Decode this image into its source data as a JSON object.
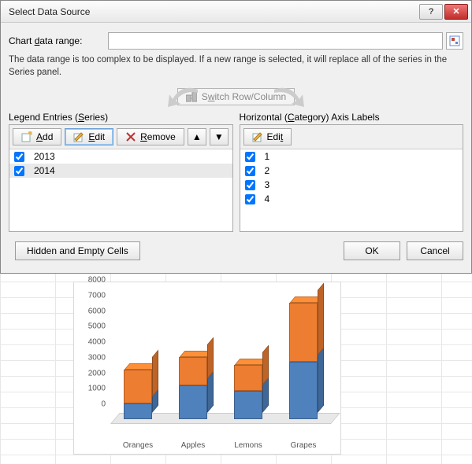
{
  "dialog": {
    "title": "Select Data Source",
    "range_label": "Chart data range:",
    "range_value": "",
    "note": "The data range is too complex to be displayed. If a new range is selected, it will replace all of the series in the Series panel.",
    "switch_label": "Switch Row/Column",
    "legend_heading_pre": "Legend Entries (",
    "legend_heading_ul": "S",
    "legend_heading_post": "eries)",
    "category_heading_pre": "Horizontal (",
    "category_heading_ul": "C",
    "category_heading_post": "ategory) Axis Labels",
    "buttons": {
      "add": "Add",
      "edit": "Edit",
      "remove": "Remove",
      "hidden": "Hidden and Empty Cells",
      "ok": "OK",
      "cancel": "Cancel"
    },
    "series": [
      {
        "label": "2013",
        "checked": true,
        "selected": false
      },
      {
        "label": "2014",
        "checked": true,
        "selected": true
      }
    ],
    "categories": [
      {
        "label": "1",
        "checked": true
      },
      {
        "label": "2",
        "checked": true
      },
      {
        "label": "3",
        "checked": true
      },
      {
        "label": "4",
        "checked": true
      }
    ]
  },
  "chart_data": {
    "type": "bar",
    "stacked": true,
    "is_3d": true,
    "categories": [
      "Oranges",
      "Apples",
      "Lemons",
      "Grapes"
    ],
    "series": [
      {
        "name": "2013",
        "color": "#4f81bd",
        "values": [
          1000,
          2200,
          1800,
          3700
        ]
      },
      {
        "name": "2014",
        "color": "#ed7d31",
        "values": [
          2200,
          1800,
          1700,
          3800
        ]
      }
    ],
    "ylim": [
      0,
      8000
    ],
    "ytick_step": 1000,
    "yticks": [
      0,
      1000,
      2000,
      3000,
      4000,
      5000,
      6000,
      7000,
      8000
    ]
  }
}
